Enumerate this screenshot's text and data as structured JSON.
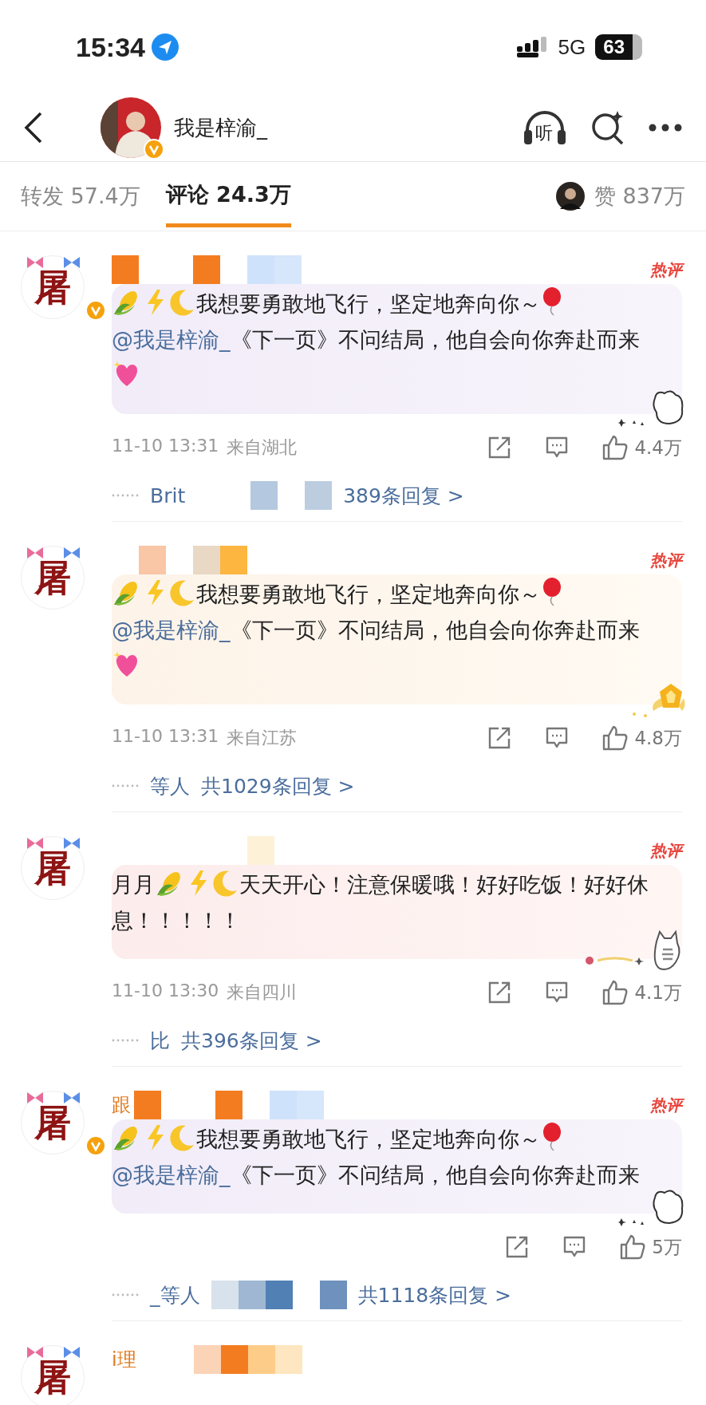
{
  "status_bar": {
    "time": "15:34",
    "network": "5G",
    "battery": "63"
  },
  "nav": {
    "name": "我是梓渝_",
    "verified": true,
    "listen_label": "听"
  },
  "tabs": [
    {
      "label": "转发",
      "count": "57.4万",
      "selected": false
    },
    {
      "label": "评论",
      "count": "24.3万",
      "selected": true
    }
  ],
  "likes_tab": {
    "label": "赞",
    "count": "837万"
  },
  "comments": [
    {
      "avatar_char": "屠",
      "verified": true,
      "mosaic": {
        "kind": "orange"
      },
      "hot_label": "热评",
      "bubble": {
        "kind": "lavender"
      },
      "sticker": {
        "kind": "bear"
      },
      "content": [
        {
          "kind": "emojis"
        },
        {
          "kind": "text",
          "text": "我想要勇敢地飞行，坚定地奔向你～"
        },
        {
          "kind": "balloon"
        },
        {
          "kind": "mention",
          "text": "@我是梓渝_"
        },
        {
          "kind": "text",
          "text": "《下一页》不问结局，他自会向你奔赴而来"
        },
        {
          "kind": "heart"
        }
      ],
      "time": "11-10 13:31",
      "location": "来自湖北",
      "likes": "4.4万",
      "reply_prefix": "Brit",
      "reply_mosaic": {
        "kind": "blue"
      },
      "reply_summary": "389条回复 >"
    },
    {
      "avatar_char": "屠",
      "verified": false,
      "mosaic": {
        "kind": "peach"
      },
      "hot_label": "热评",
      "bubble": {
        "kind": "peach"
      },
      "sticker": {
        "kind": "medal"
      },
      "content": [
        {
          "kind": "emojis"
        },
        {
          "kind": "text",
          "text": "我想要勇敢地飞行，坚定地奔向你～"
        },
        {
          "kind": "balloon"
        },
        {
          "kind": "mention",
          "text": "@我是梓渝_"
        },
        {
          "kind": "text",
          "text": "《下一页》不问结局，他自会向你奔赴而来"
        },
        {
          "kind": "heart"
        }
      ],
      "time": "11-10 13:31",
      "location": "来自江苏",
      "likes": "4.8万",
      "reply_prefix": "等人",
      "reply_summary": "共1029条回复 >"
    },
    {
      "avatar_char": "屠",
      "verified": false,
      "mosaic": {
        "kind": "faint"
      },
      "hot_label": "热评",
      "bubble": {
        "kind": "pink"
      },
      "sticker": {
        "kind": "cat"
      },
      "content": [
        {
          "kind": "text",
          "text": "月月"
        },
        {
          "kind": "emojis"
        },
        {
          "kind": "text",
          "text": "天天开心！注意保暖哦！好好吃饭！好好休息！！！！！"
        }
      ],
      "time": "11-10 13:30",
      "location": "来自四川",
      "likes": "4.1万",
      "reply_prefix": "比",
      "reply_summary": "共396条回复 >"
    },
    {
      "avatar_char": "屠",
      "verified": true,
      "name_partial": "跟",
      "mosaic": {
        "kind": "orange"
      },
      "hot_label": "热评",
      "bubble": {
        "kind": "lavender"
      },
      "sticker": {
        "kind": "bear"
      },
      "content": [
        {
          "kind": "emojis"
        },
        {
          "kind": "text",
          "text": "我想要勇敢地飞行，坚定地奔向你～"
        },
        {
          "kind": "balloon"
        },
        {
          "kind": "mention",
          "text": "@我是梓渝_"
        },
        {
          "kind": "text",
          "text": "《下一页》不问结局，他自会向你奔赴而来"
        }
      ],
      "likes": "5万",
      "reply_mosaic": {
        "kind": "steel"
      },
      "reply_prefix": "_等人",
      "reply_summary": "共1118条回复 >"
    },
    {
      "avatar_char": "屠",
      "name_partial": "i理",
      "mosaic": {
        "kind": "sunset"
      }
    }
  ]
}
